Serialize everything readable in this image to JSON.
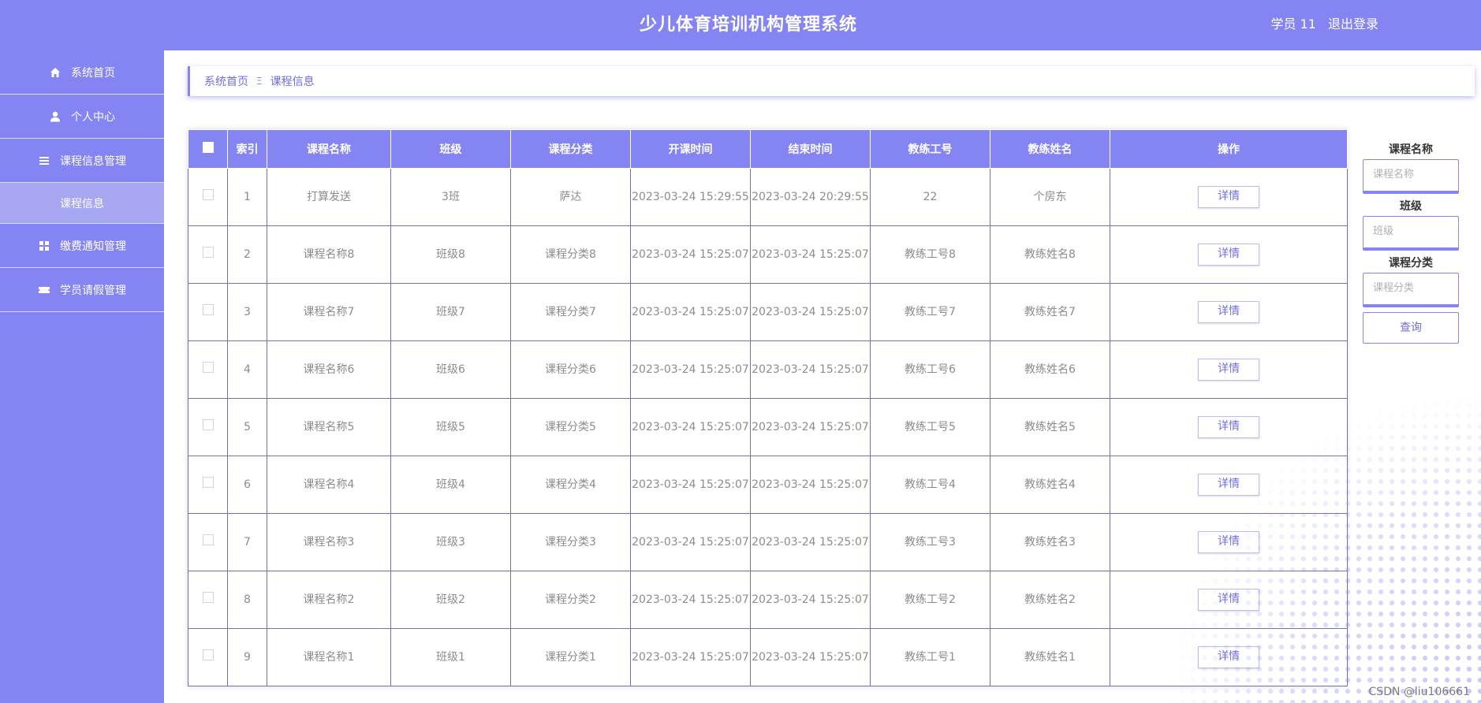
{
  "header": {
    "title": "少儿体育培训机构管理系统",
    "user": "学员 11",
    "logout": "退出登录"
  },
  "sidebar": {
    "items": [
      {
        "label": "系统首页",
        "icon": "home-icon"
      },
      {
        "label": "个人中心",
        "icon": "user-icon"
      },
      {
        "label": "课程信息管理",
        "icon": "list-icon"
      },
      {
        "label": "课程信息",
        "icon": ""
      },
      {
        "label": "缴费通知管理",
        "icon": "grid-icon"
      },
      {
        "label": "学员请假管理",
        "icon": "ticket-icon"
      }
    ]
  },
  "breadcrumb": {
    "home": "系统首页",
    "separator": "Ξ",
    "current": "课程信息"
  },
  "table": {
    "headers": [
      "",
      "索引",
      "课程名称",
      "班级",
      "课程分类",
      "开课时间",
      "结束时间",
      "教练工号",
      "教练姓名",
      "操作"
    ],
    "detail_label": "详情",
    "rows": [
      {
        "index": "1",
        "name": "打算发送",
        "class": "3班",
        "category": "萨达",
        "start": "2023-03-24 15:29:55",
        "end": "2023-03-24 20:29:55",
        "coach_id": "22",
        "coach_name": "个房东"
      },
      {
        "index": "2",
        "name": "课程名称8",
        "class": "班级8",
        "category": "课程分类8",
        "start": "2023-03-24 15:25:07",
        "end": "2023-03-24 15:25:07",
        "coach_id": "教练工号8",
        "coach_name": "教练姓名8"
      },
      {
        "index": "3",
        "name": "课程名称7",
        "class": "班级7",
        "category": "课程分类7",
        "start": "2023-03-24 15:25:07",
        "end": "2023-03-24 15:25:07",
        "coach_id": "教练工号7",
        "coach_name": "教练姓名7"
      },
      {
        "index": "4",
        "name": "课程名称6",
        "class": "班级6",
        "category": "课程分类6",
        "start": "2023-03-24 15:25:07",
        "end": "2023-03-24 15:25:07",
        "coach_id": "教练工号6",
        "coach_name": "教练姓名6"
      },
      {
        "index": "5",
        "name": "课程名称5",
        "class": "班级5",
        "category": "课程分类5",
        "start": "2023-03-24 15:25:07",
        "end": "2023-03-24 15:25:07",
        "coach_id": "教练工号5",
        "coach_name": "教练姓名5"
      },
      {
        "index": "6",
        "name": "课程名称4",
        "class": "班级4",
        "category": "课程分类4",
        "start": "2023-03-24 15:25:07",
        "end": "2023-03-24 15:25:07",
        "coach_id": "教练工号4",
        "coach_name": "教练姓名4"
      },
      {
        "index": "7",
        "name": "课程名称3",
        "class": "班级3",
        "category": "课程分类3",
        "start": "2023-03-24 15:25:07",
        "end": "2023-03-24 15:25:07",
        "coach_id": "教练工号3",
        "coach_name": "教练姓名3"
      },
      {
        "index": "8",
        "name": "课程名称2",
        "class": "班级2",
        "category": "课程分类2",
        "start": "2023-03-24 15:25:07",
        "end": "2023-03-24 15:25:07",
        "coach_id": "教练工号2",
        "coach_name": "教练姓名2"
      },
      {
        "index": "9",
        "name": "课程名称1",
        "class": "班级1",
        "category": "课程分类1",
        "start": "2023-03-24 15:25:07",
        "end": "2023-03-24 15:25:07",
        "coach_id": "教练工号1",
        "coach_name": "教练姓名1"
      }
    ]
  },
  "search": {
    "course_name_label": "课程名称",
    "course_name_placeholder": "课程名称",
    "class_label": "班级",
    "class_placeholder": "班级",
    "category_label": "课程分类",
    "category_placeholder": "课程分类",
    "query_label": "查询"
  },
  "watermark": "CSDN @liu106661",
  "colors": {
    "accent": "#8584f3",
    "sidebar_active": "#a7a6f1",
    "text_muted": "#8c8c8c"
  }
}
